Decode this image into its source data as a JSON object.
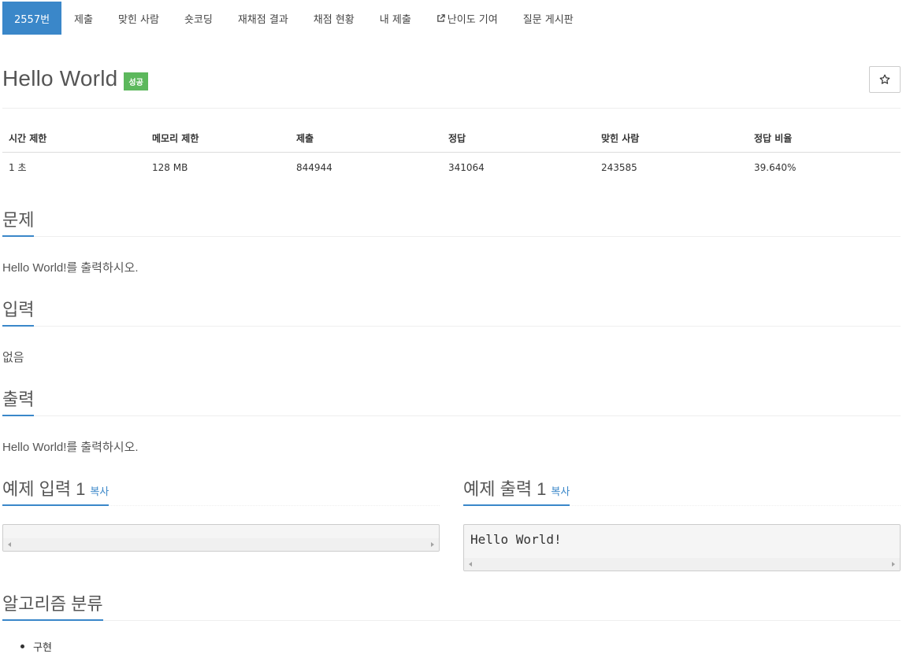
{
  "nav": {
    "items": [
      {
        "label": "2557번",
        "active": true
      },
      {
        "label": "제출"
      },
      {
        "label": "맞힌 사람"
      },
      {
        "label": "숏코딩"
      },
      {
        "label": "재채점 결과"
      },
      {
        "label": "채점 현황"
      },
      {
        "label": "내 제출"
      },
      {
        "label": "난이도 기여",
        "icon": "external-link-icon"
      },
      {
        "label": "질문 게시판"
      }
    ]
  },
  "problem": {
    "title": "Hello World",
    "badge": "성공",
    "star_icon": "star-icon"
  },
  "info_table": {
    "headers": [
      "시간 제한",
      "메모리 제한",
      "제출",
      "정답",
      "맞힌 사람",
      "정답 비율"
    ],
    "values": [
      "1 초",
      "128 MB",
      "844944",
      "341064",
      "243585",
      "39.640%"
    ]
  },
  "sections": {
    "problem": {
      "heading": "문제",
      "text": "Hello World!를 출력하시오."
    },
    "input": {
      "heading": "입력",
      "text": "없음"
    },
    "output": {
      "heading": "출력",
      "text": "Hello World!를 출력하시오."
    }
  },
  "samples": {
    "input": {
      "heading": "예제 입력 1",
      "copy": "복사",
      "content": ""
    },
    "output": {
      "heading": "예제 출력 1",
      "copy": "복사",
      "content": "Hello World!"
    }
  },
  "algorithm": {
    "heading": "알고리즘 분류",
    "tags": [
      "구현"
    ]
  },
  "colors": {
    "accent": "#3a87c9",
    "success": "#5cb85c"
  }
}
